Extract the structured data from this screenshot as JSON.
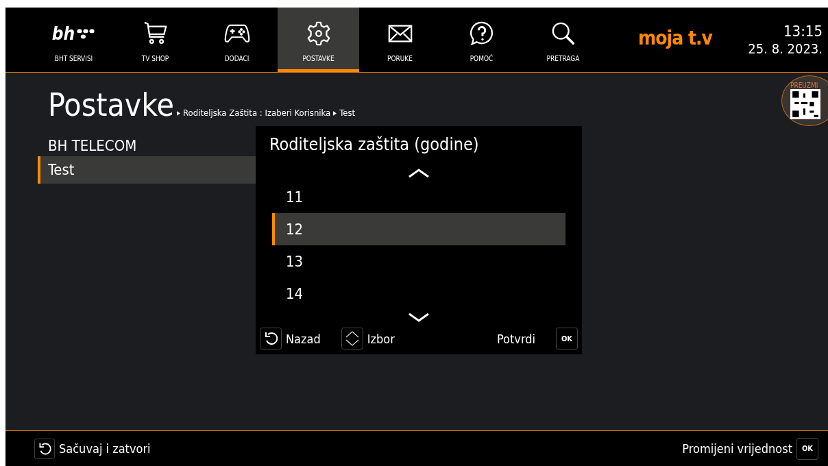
{
  "nav": {
    "logo": "bh",
    "items": [
      {
        "kind": "logo",
        "label": "BHT SERVISI",
        "selected": false
      },
      {
        "kind": "cart",
        "label": "TV SHOP",
        "selected": false
      },
      {
        "kind": "gamepad",
        "label": "DODACI",
        "selected": false
      },
      {
        "kind": "gear",
        "label": "POSTAVKE",
        "selected": true
      },
      {
        "kind": "mail",
        "label": "PORUKE",
        "selected": false
      },
      {
        "kind": "help",
        "label": "POMOĆ",
        "selected": false
      },
      {
        "kind": "search",
        "label": "PRETRAGA",
        "selected": false
      }
    ],
    "brand": "moja t.v",
    "time": "13:15",
    "date": "25. 8. 2023."
  },
  "qr_badge": {
    "label": "PREUZMI"
  },
  "page": {
    "title": "Postavke",
    "breadcrumb": [
      "Roditeljska Zaštita : Izaberi Korisnika",
      "Test"
    ]
  },
  "users": {
    "heading": "BH TELECOM",
    "items": [
      {
        "label": "Test",
        "selected": true
      }
    ]
  },
  "dialog": {
    "title": "Roditeljska zaštita (godine)",
    "options": [
      {
        "label": "11",
        "selected": false
      },
      {
        "label": "12",
        "selected": true
      },
      {
        "label": "13",
        "selected": false
      },
      {
        "label": "14",
        "selected": false
      }
    ],
    "hints": [
      {
        "kind": "back",
        "label": "Nazad"
      },
      {
        "kind": "updown",
        "label": "Izbor"
      }
    ],
    "confirm": {
      "label": "Potvrdi",
      "key": "OK"
    }
  },
  "footer": {
    "left": {
      "kind": "back",
      "label": "Sačuvaj i zatvori"
    },
    "right": {
      "label": "Promijeni vrijednost",
      "key": "OK"
    }
  }
}
